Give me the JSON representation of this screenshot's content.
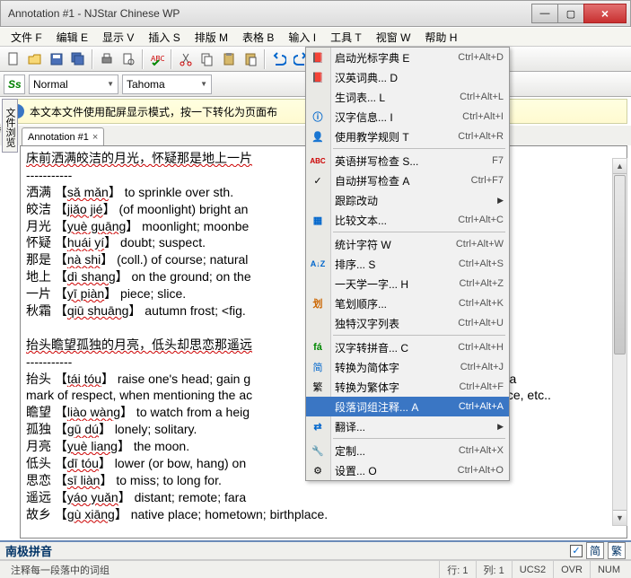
{
  "window": {
    "title": "Annotation #1 - NJStar Chinese WP",
    "min": "—",
    "max": "▢",
    "close": "×"
  },
  "menus": [
    "文件 F",
    "编辑 E",
    "显示 V",
    "插入 S",
    "排版 M",
    "表格 B",
    "输入 I",
    "工具 T",
    "视窗 W",
    "帮助 H"
  ],
  "combo": {
    "ss": "Ss",
    "style": "Normal",
    "font": "Tahoma"
  },
  "info": {
    "text": "本文本文件使用配屏显示模式，按一下转化为页面布",
    "close": "×"
  },
  "sidetab": "文件浏览器",
  "tab": {
    "name": "Annotation #1",
    "close": "×"
  },
  "doc": {
    "l1": "床前洒满皎洁的月光，怀疑那是地上一片",
    "l2": "-----------",
    "l3a": "洒满 【",
    "l3b": "sǎ mǎn",
    "l3c": "】 to sprinkle over sth.",
    "l4a": "皎洁 【",
    "l4b": "jiǎo jié",
    "l4c": "】 (of moonlight) bright an",
    "l5a": "月光 【",
    "l5b": "yuè guāng",
    "l5c": "】 moonlight; moonbe",
    "l6a": "怀疑 【",
    "l6b": "huái yí",
    "l6c": "】 doubt; suspect.",
    "l7a": "那是 【",
    "l7b": "nà shi",
    "l7c": "】 (coll.) of course; natural",
    "l8a": "地上 【",
    "l8b": "dì shang",
    "l8c": "】 on the ground; on the",
    "l9a": "一片 【",
    "l9b": "yī piàn",
    "l9c": "】 piece; slice.",
    "l10a": "秋霜 【",
    "l10b": "qiū shuāng",
    "l10c": "】 autumn frost; <fig.",
    "l11": "",
    "l12": "抬头瞻望孤独的月亮，低头却思恋那遥远",
    "l13": "-----------",
    "l14a": "抬头 【",
    "l14b": "tái tóu",
    "l14c": "】 raise one's head; gain g",
    "l14d": "w line,as a",
    "l15": "mark of respect, when mentioning the ac",
    "l15d": "spondence, etc..",
    "l16a": "瞻望 【",
    "l16b": "liào wàng",
    "l16c": "】 to watch from a heig",
    "l17a": "孤独 【",
    "l17b": "gū dú",
    "l17c": "】 lonely; solitary.",
    "l18a": "月亮 【",
    "l18b": "yuè liang",
    "l18c": "】 the moon.",
    "l19a": "低头 【",
    "l19b": "dī tóu",
    "l19c": "】 lower (or bow, hang) on",
    "l20a": "思恋 【",
    "l20b": "sī liàn",
    "l20c": "】 to miss; to long for.",
    "l21a": "遥远 【",
    "l21b": "yáo yuǎn",
    "l21c": "】 distant; remote; fara",
    "l22a": "故乡 【",
    "l22b": "gù xiāng",
    "l22c": "】 native place; hometown; birthplace."
  },
  "dropdown": [
    {
      "ic": "book",
      "label": "启动光标字典 E",
      "sc": "Ctrl+Alt+D"
    },
    {
      "ic": "book",
      "label": "汉英词典... D",
      "sc": ""
    },
    {
      "ic": "",
      "label": "生词表... L",
      "sc": "Ctrl+Alt+L"
    },
    {
      "ic": "info",
      "label": "汉字信息... I",
      "sc": "Ctrl+Alt+I"
    },
    {
      "ic": "user",
      "label": "使用教学规则 T",
      "sc": "Ctrl+Alt+R"
    },
    {
      "sep": true
    },
    {
      "ic": "abc",
      "label": "英语拼写检查 S...",
      "sc": "F7"
    },
    {
      "ic": "chk",
      "label": "自动拼写检查 A",
      "sc": "Ctrl+F7"
    },
    {
      "ic": "",
      "label": "跟踪改动",
      "sc": "",
      "arrow": true
    },
    {
      "ic": "cmp",
      "label": "比较文本...",
      "sc": "Ctrl+Alt+C"
    },
    {
      "sep": true
    },
    {
      "ic": "",
      "label": "统计字符 W",
      "sc": "Ctrl+Alt+W"
    },
    {
      "ic": "az",
      "label": "排序... S",
      "sc": "Ctrl+Alt+S"
    },
    {
      "ic": "",
      "label": "一天学一字... H",
      "sc": "Ctrl+Alt+Z"
    },
    {
      "ic": "pen",
      "label": "笔划顺序...",
      "sc": "Ctrl+Alt+K"
    },
    {
      "ic": "",
      "label": "独特汉字列表",
      "sc": "Ctrl+Alt+U"
    },
    {
      "sep": true
    },
    {
      "ic": "fa",
      "label": "汉字转拼音... C",
      "sc": "Ctrl+Alt+H"
    },
    {
      "ic": "jian",
      "label": "转换为简体字",
      "sc": "Ctrl+Alt+J"
    },
    {
      "ic": "fan",
      "label": "转换为繁体字",
      "sc": "Ctrl+Alt+F"
    },
    {
      "ic": "",
      "label": "段落词组注释... A",
      "sc": "Ctrl+Alt+A",
      "sel": true
    },
    {
      "ic": "tr",
      "label": "翻译...",
      "sc": "",
      "arrow": true
    },
    {
      "sep": true
    },
    {
      "ic": "wr",
      "label": "定制...",
      "sc": "Ctrl+Alt+X"
    },
    {
      "ic": "gear",
      "label": "设置... O",
      "sc": "Ctrl+Alt+O"
    }
  ],
  "ime": {
    "name": "南极拼音",
    "jian": "简",
    "fan": "繁"
  },
  "status": {
    "hint": "注释每一段落中的词组",
    "line": "行: 1",
    "col": "列: 1",
    "enc": "UCS2",
    "ovr": "OVR",
    "num": "NUM"
  }
}
